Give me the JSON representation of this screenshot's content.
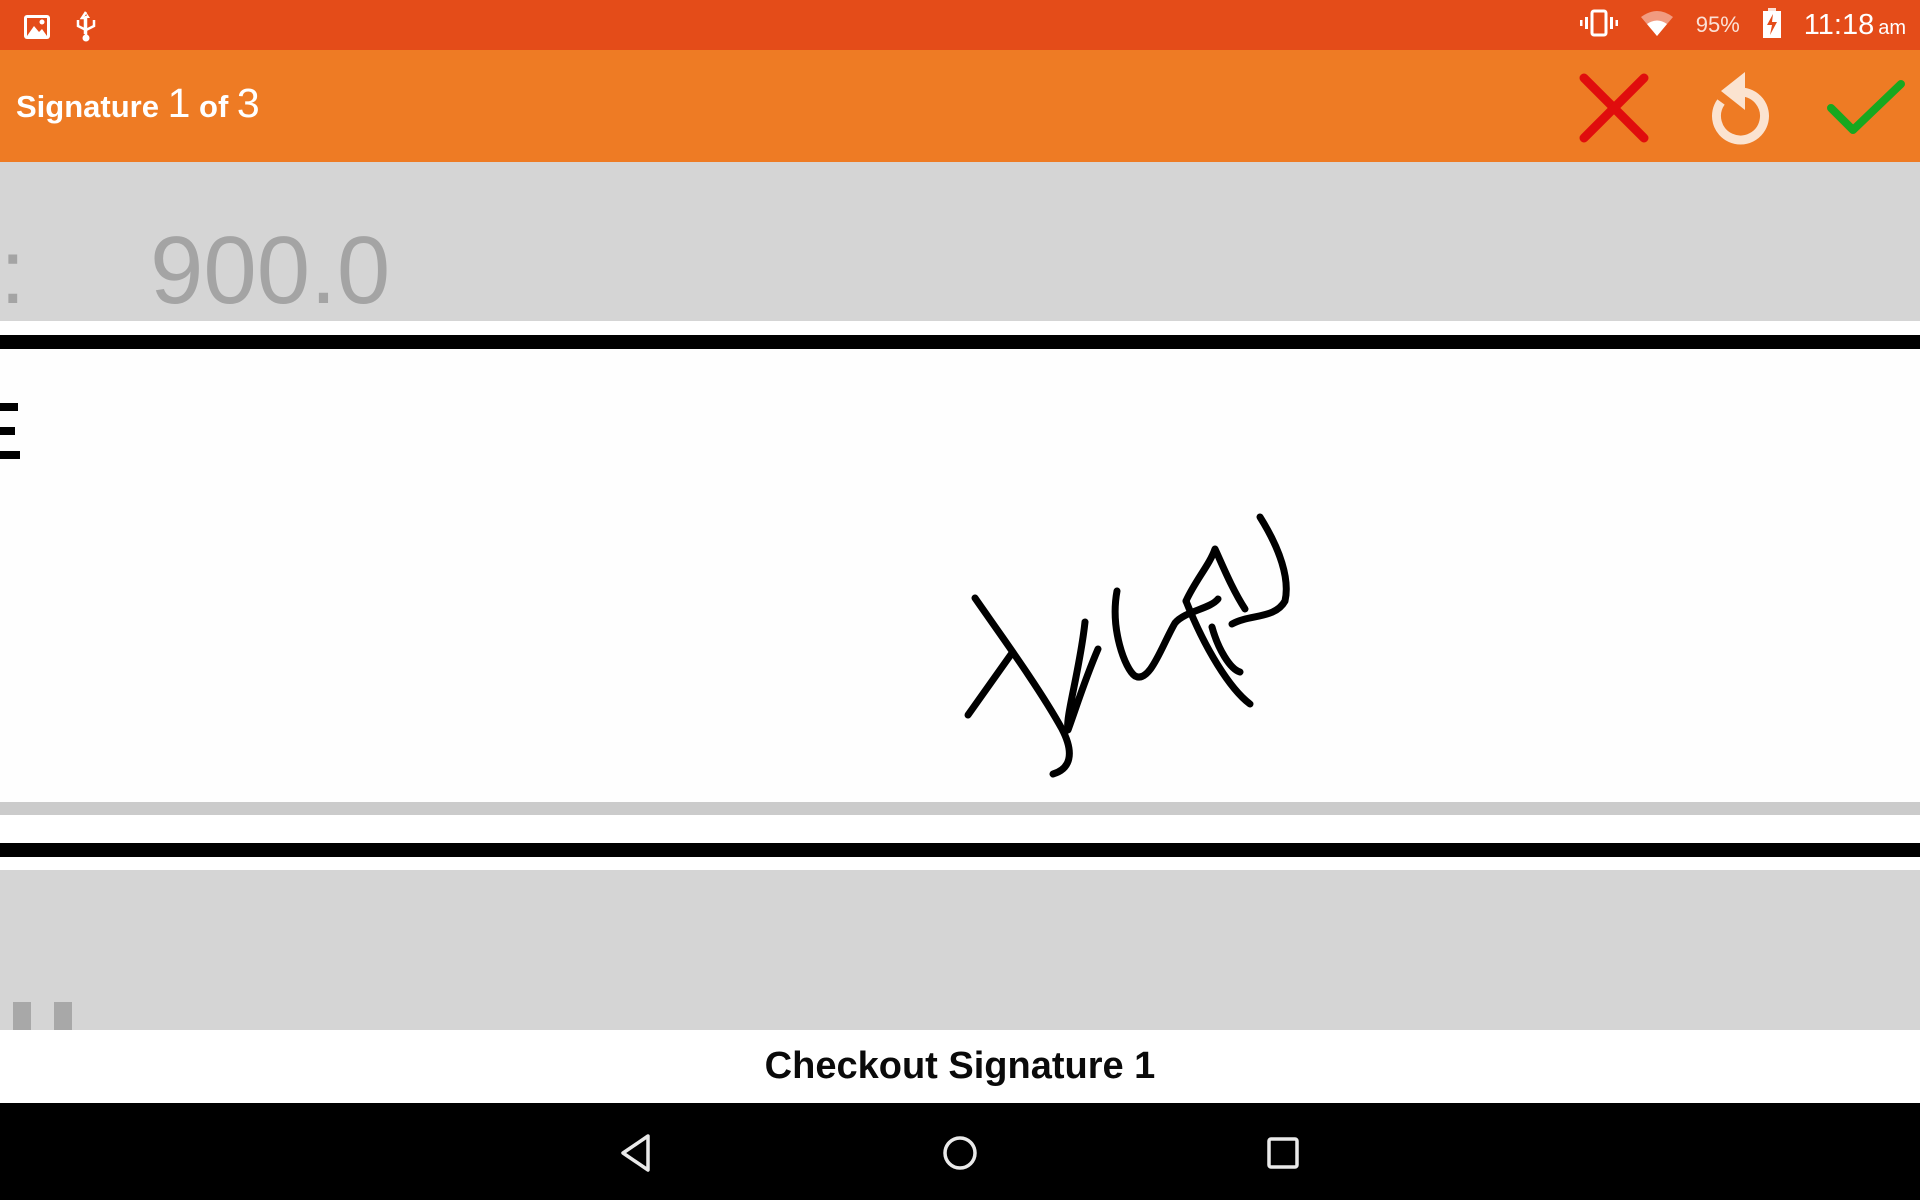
{
  "status_bar": {
    "left_icons": [
      "gallery-icon",
      "usb-icon"
    ],
    "right_icons": [
      "vibrate-icon",
      "wifi-icon",
      "battery-charging-icon"
    ],
    "battery_percent": "95%",
    "time": "11:18",
    "ampm": "am"
  },
  "toolbar": {
    "title_prefix": "Signature",
    "current": "1",
    "of_label": "of",
    "total": "3",
    "actions": [
      {
        "name": "cancel",
        "icon": "close-icon",
        "color": "#e00d0d"
      },
      {
        "name": "clear",
        "icon": "undo-icon",
        "color": "#fbe3d0"
      },
      {
        "name": "accept",
        "icon": "check-icon",
        "color": "#17a81f"
      }
    ]
  },
  "form": {
    "amount_prefix": ":",
    "amount_value": "900.0"
  },
  "signature_label": "Checkout Signature 1",
  "nav_bar": {
    "buttons": [
      "back-icon",
      "home-icon",
      "recents-icon"
    ]
  },
  "colors": {
    "status_bar": "#e44c19",
    "toolbar": "#ee7b24",
    "band": "#d5d5d5",
    "amount_text": "#a4a4a4"
  }
}
